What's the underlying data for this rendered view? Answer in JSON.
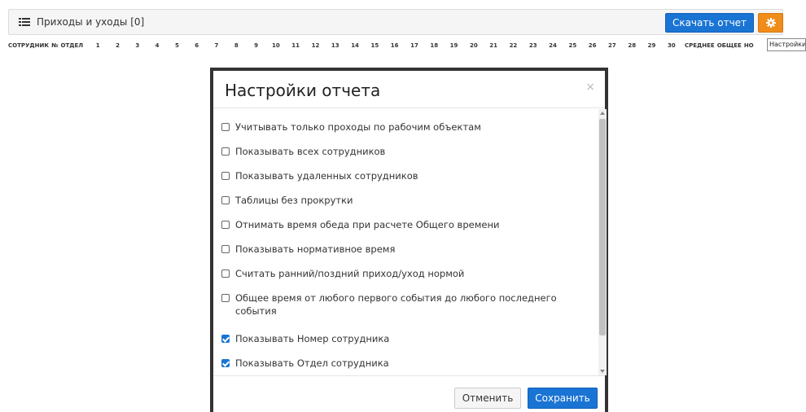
{
  "panel": {
    "title": "Приходы и уходы [0]",
    "download_label": "Скачать отчет",
    "settings_tooltip": "Настройки"
  },
  "columns": {
    "employee": "СОТРУДНИК",
    "number": "№",
    "department": "ОТДЕЛ",
    "days": [
      "1",
      "2",
      "3",
      "4",
      "5",
      "6",
      "7",
      "8",
      "9",
      "10",
      "11",
      "12",
      "13",
      "14",
      "15",
      "16",
      "17",
      "18",
      "19",
      "20",
      "21",
      "22",
      "23",
      "24",
      "25",
      "26",
      "27",
      "28",
      "29",
      "30"
    ],
    "average": "СРЕДНЕЕ",
    "total": "ОБЩЕЕ",
    "norm": "НО"
  },
  "modal": {
    "title": "Настройки отчета",
    "close": "×",
    "options": [
      {
        "label": "Учитывать только проходы по рабочим объектам",
        "checked": false
      },
      {
        "label": "Показывать всех сотрудников",
        "checked": false
      },
      {
        "label": "Показывать удаленных сотрудников",
        "checked": false
      },
      {
        "label": "Таблицы без прокрутки",
        "checked": false
      },
      {
        "label": "Отнимать время обеда при расчете Общего времени",
        "checked": false
      },
      {
        "label": "Показывать нормативное время",
        "checked": false
      },
      {
        "label": "Считать ранний/поздний приход/уход нормой",
        "checked": false
      },
      {
        "label": "Общее время от любого первого события до любого последнего события",
        "checked": false
      },
      {
        "label": "Показывать Номер сотрудника",
        "checked": true
      },
      {
        "label": "Показывать Отдел сотрудника",
        "checked": true
      }
    ],
    "cancel_label": "Отменить",
    "save_label": "Сохранить"
  },
  "colors": {
    "primary": "#1a74d4",
    "warning": "#f08c1a"
  }
}
